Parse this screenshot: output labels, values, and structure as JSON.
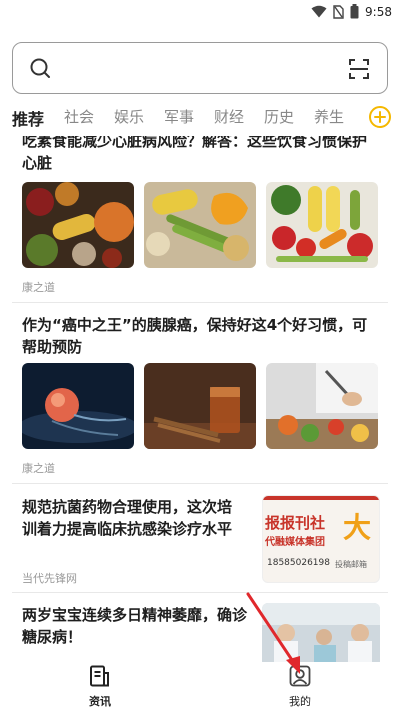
{
  "status_bar": {
    "time": "9:58"
  },
  "tabs": [
    "推荐",
    "社会",
    "娱乐",
    "军事",
    "财经",
    "历史",
    "养生"
  ],
  "feed": [
    {
      "title": "吃素食能减少心脏病风险？解答：这些饮食习惯保护心脏",
      "source": "康之道"
    },
    {
      "title": "作为“癌中之王”的胰腺癌，保持好这4个好习惯，可帮助预防",
      "source": "康之道"
    },
    {
      "title": "规范抗菌药物合理使用，这次培训着力提高临床抗感染诊疗水平",
      "source": "当代先锋网",
      "thumb_text": {
        "line1": "报报刊社",
        "line2": "代融媒体集团",
        "phone": "18585026198",
        "big_char": "大",
        "small": "投稿邮箱"
      }
    },
    {
      "title": "两岁宝宝连续多日精神萎靡，确诊糖尿病！"
    }
  ],
  "bottom_nav": [
    {
      "label": "资讯",
      "icon": "news-icon",
      "active": true
    },
    {
      "label": "我的",
      "icon": "profile-icon",
      "active": false
    }
  ],
  "colors": {
    "accent": "#f5b800",
    "annotation_arrow": "#e0282c"
  }
}
